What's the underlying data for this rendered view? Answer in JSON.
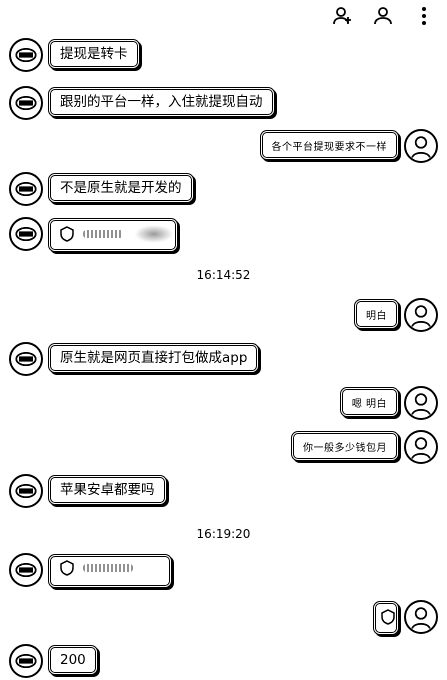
{
  "timestamps": [
    "16:14:52",
    "16:19:20"
  ],
  "messages": {
    "m1": "提现是转卡",
    "m2": "跟别的平台一样，入住就提现自动",
    "m3": "各个平台提现要求不一样",
    "m4": "不是原生就是开发的",
    "m6": "明白",
    "m7": "原生就是网页直接打包做成app",
    "m8": "嗯 明白",
    "m9": "你一般多少钱包月",
    "m10": "苹果安卓都要吗",
    "m13": "200"
  },
  "icons": {
    "add_contact": "person-plus-icon",
    "contact": "person-icon",
    "more": "more-vertical-icon",
    "avatar_self": "avatar-logo-icon",
    "avatar_other": "avatar-logo-icon",
    "shield": "shield-icon"
  }
}
